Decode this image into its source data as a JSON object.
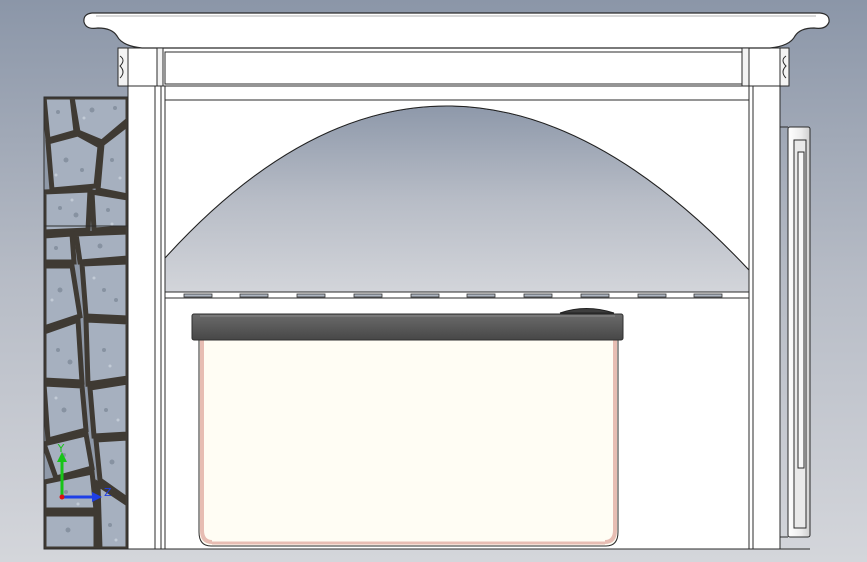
{
  "viewport": {
    "background_top": "#8b96a8",
    "background_bottom": "#d2d4d9"
  },
  "colors": {
    "frame_fill": "#ffffff",
    "frame_stroke": "#2b2b2b",
    "lid_fill": "#5a5a5a",
    "lid_stroke": "#2f2f2f",
    "basin_fill": "#fffdf4",
    "basin_edge": "#e7bdb3",
    "stone_base": "#8c97a6",
    "grout": "#3f3a33",
    "axis_y": "#18c418",
    "axis_z": "#1f3fe6"
  },
  "triad": {
    "y_label": "Y",
    "z_label": "Z"
  }
}
